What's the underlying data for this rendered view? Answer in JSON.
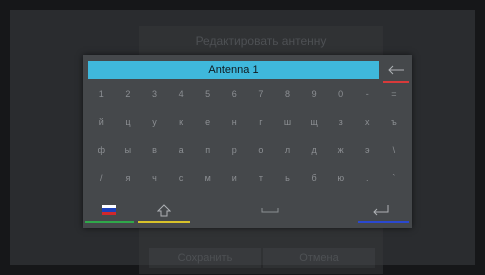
{
  "background_dialog": {
    "title": "Редактировать антенну",
    "save_label": "Сохранить",
    "cancel_label": "Отмена"
  },
  "keyboard": {
    "input_value": "Antenna 1",
    "rows": [
      [
        "1",
        "2",
        "3",
        "4",
        "5",
        "6",
        "7",
        "8",
        "9",
        "0",
        "-",
        "="
      ],
      [
        "й",
        "ц",
        "у",
        "к",
        "е",
        "н",
        "г",
        "ш",
        "щ",
        "з",
        "х",
        "ъ"
      ],
      [
        "ф",
        "ы",
        "в",
        "а",
        "п",
        "р",
        "о",
        "л",
        "д",
        "ж",
        "э",
        "\\"
      ],
      [
        "/",
        "я",
        "ч",
        "с",
        "м",
        "и",
        "т",
        "ь",
        "б",
        "ю",
        ".",
        "`"
      ]
    ],
    "icons": {
      "backspace": "backspace-icon",
      "language": "russian-flag-icon",
      "shift": "shift-icon",
      "space": "space-icon",
      "enter": "enter-icon"
    }
  },
  "colors": {
    "input_bg": "#3fb8dc",
    "red_key": "#d83a3a",
    "green_key": "#2fa84a",
    "yellow_key": "#d8c22a",
    "blue_key": "#2a48d0",
    "flag": [
      "#ffffff",
      "#1c3fb8",
      "#d0282c"
    ]
  }
}
